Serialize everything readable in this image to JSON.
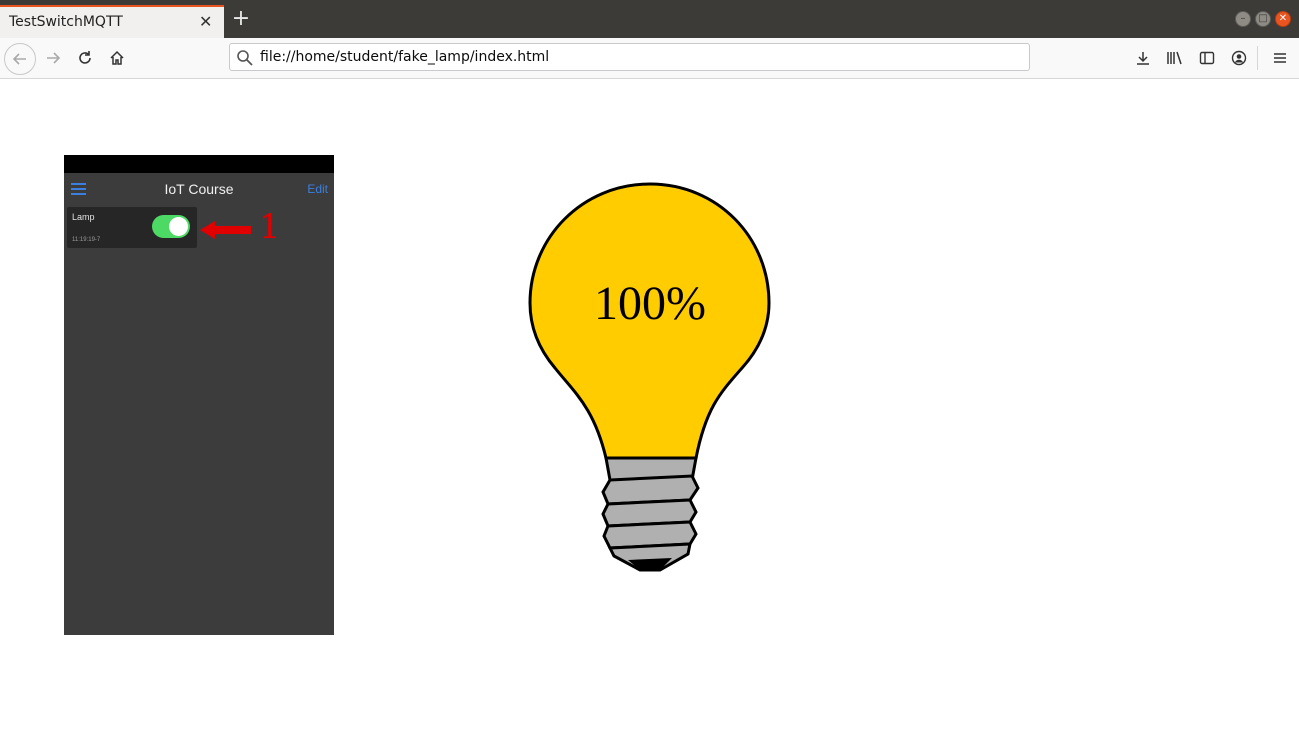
{
  "browser": {
    "tab_title": "TestSwitchMQTT",
    "url": "file://home/student/fake_lamp/index.html"
  },
  "phone": {
    "title": "IoT Course",
    "edit_label": "Edit",
    "tile": {
      "label": "Lamp",
      "timestamp": "11:19:19-7",
      "switch_on": true
    }
  },
  "annotation": {
    "number": "1",
    "color": "#e00000"
  },
  "lamp": {
    "brightness_text": "100%",
    "brightness_percent": 100,
    "bulb_color": "#ffcc00"
  }
}
